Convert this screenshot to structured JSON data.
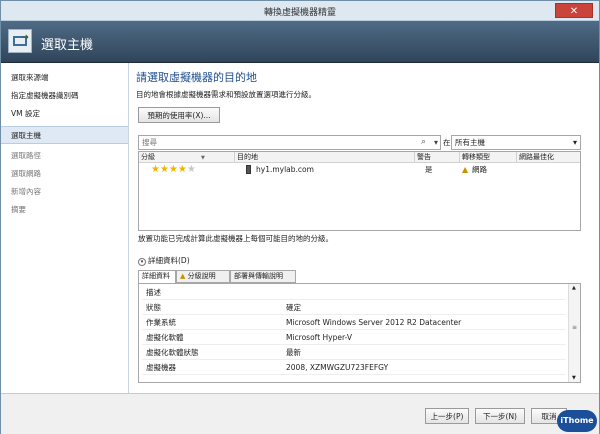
{
  "window": {
    "title": "轉換虛擬機器精靈",
    "close_label": "✕"
  },
  "header": {
    "title": "選取主機"
  },
  "sidebar": {
    "items": [
      {
        "label": "選取來源端"
      },
      {
        "label": "指定虛擬機器識別碼"
      },
      {
        "label": "VM 設定"
      },
      {
        "label": "選取主機"
      },
      {
        "label": "選取路徑"
      },
      {
        "label": "選取網路"
      },
      {
        "label": "新增內容"
      },
      {
        "label": "摘要"
      }
    ]
  },
  "main": {
    "title": "請選取虛擬機器的目的地",
    "description": "目的地會根據虛擬機器需求和預設放置選項進行分級。",
    "usage_button": "預期的使用率(X)..."
  },
  "search": {
    "placeholder": "搜尋",
    "in_label": "在(I)",
    "scope_value": "所有主機"
  },
  "table": {
    "columns": [
      "分級",
      "目的地",
      "警告",
      "轉移類型",
      "網路最佳化"
    ],
    "rows": [
      {
        "rating": 4,
        "destination": "hy1.mylab.com",
        "warning": "是",
        "transfer_type": "網路",
        "network_opt": ""
      }
    ]
  },
  "status_text": "放置功能已完成計算此虛擬機器上每個可能目的地的分級。",
  "details": {
    "toggle_label": "詳細資料(D)",
    "tabs": [
      "詳細資料",
      "分級說明",
      "部署與傳輸說明"
    ],
    "rows": [
      {
        "key": "描述",
        "value": ""
      },
      {
        "key": "狀態",
        "value": "確定"
      },
      {
        "key": "作業系統",
        "value": "Microsoft Windows Server 2012 R2 Datacenter"
      },
      {
        "key": "虛擬化軟體",
        "value": "Microsoft Hyper-V"
      },
      {
        "key": "虛擬化軟體狀態",
        "value": "最新"
      },
      {
        "key": "虛擬機器",
        "value": "2008, XZMWGZU723FEFGY"
      }
    ]
  },
  "footer": {
    "back_label": "上一步(P)",
    "next_label": "下一步(N)",
    "cancel_label": "取消"
  },
  "watermark": {
    "label": "iThome"
  }
}
